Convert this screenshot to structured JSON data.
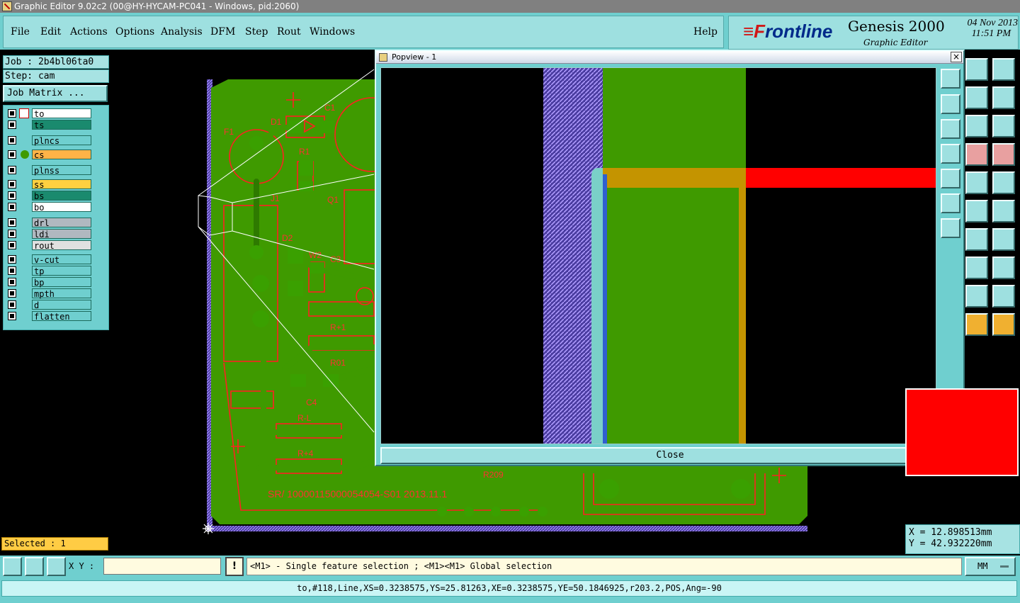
{
  "window": {
    "title": "Graphic Editor 9.02c2 (00@HY-HYCAM-PC041 - Windows, pid:2060)"
  },
  "menu": {
    "items": [
      "File",
      "Edit",
      "Actions",
      "Options",
      "Analysis",
      "DFM",
      "Step",
      "Rout",
      "Windows"
    ],
    "help": "Help"
  },
  "brand": {
    "logo_f": "≡F",
    "logo_rest": "rontline",
    "product": "Genesis 2000",
    "subtitle": "Graphic Editor",
    "date": "04 Nov 2013",
    "time": "11:51 PM"
  },
  "job": {
    "job_label": "Job : 2b4bl06ta0",
    "step_label": "Step: cam",
    "matrix_button": "Job Matrix ..."
  },
  "layers": [
    {
      "name": "to",
      "color": "#ffffff"
    },
    {
      "name": "ts",
      "color": "#1a8a6e"
    },
    {
      "name": "plncs",
      "color": "#6fcfcf"
    },
    {
      "name": "cs",
      "color": "#ffb347"
    },
    {
      "name": "plnss",
      "color": "#6fcfcf"
    },
    {
      "name": "ss",
      "color": "#ffd040"
    },
    {
      "name": "bs",
      "color": "#1a8a6e"
    },
    {
      "name": "bo",
      "color": "#ffffff"
    },
    {
      "name": "drl",
      "color": "#b0b8c0"
    },
    {
      "name": "ldi",
      "color": "#b0b8c0"
    },
    {
      "name": "rout",
      "color": "#e0e0e0"
    },
    {
      "name": "v-cut",
      "color": "#6fcfcf"
    },
    {
      "name": "tp",
      "color": "#6fcfcf"
    },
    {
      "name": "bp",
      "color": "#6fcfcf"
    },
    {
      "name": "mpth",
      "color": "#6fcfcf"
    },
    {
      "name": "d",
      "color": "#6fcfcf"
    },
    {
      "name": "flatten",
      "color": "#6fcfcf"
    }
  ],
  "selected": "Selected : 1",
  "board_labels": {
    "f1": "F1",
    "d1": "D1",
    "r1": "R1",
    "j1": "J1",
    "q1": "Q1",
    "d2": "D2",
    "w2": "W2",
    "c3": "C3",
    "c1": "C1",
    "r1b": "R+1",
    "r01": "R01",
    "c4": "C4",
    "rl": "R-L",
    "r4": "R+4",
    "r209": "R209",
    "serial": "SR/ 10000115000054054-S01 2013.11.1"
  },
  "popview": {
    "title": "Popview - 1",
    "close_x": "×",
    "close_button": "Close"
  },
  "coords": {
    "x": "X = 12.898513mm",
    "y": "Y = 42.932220mm"
  },
  "bottom": {
    "xy_label": "X Y :",
    "xy_value": "",
    "warn": "!",
    "hint": "<M1> - Single feature selection ; <M1><M1> Global selection",
    "units": "MM"
  },
  "status": "to,#118,Line,XS=0.3238575,YS=25.81263,XE=0.3238575,YE=50.1846925,r203.2,POS,Ang=-90",
  "colors": {
    "copper": "#3f9a00",
    "outline": "#ff0000",
    "keepout": "#c49400",
    "hatch": "#8c6cd8"
  }
}
